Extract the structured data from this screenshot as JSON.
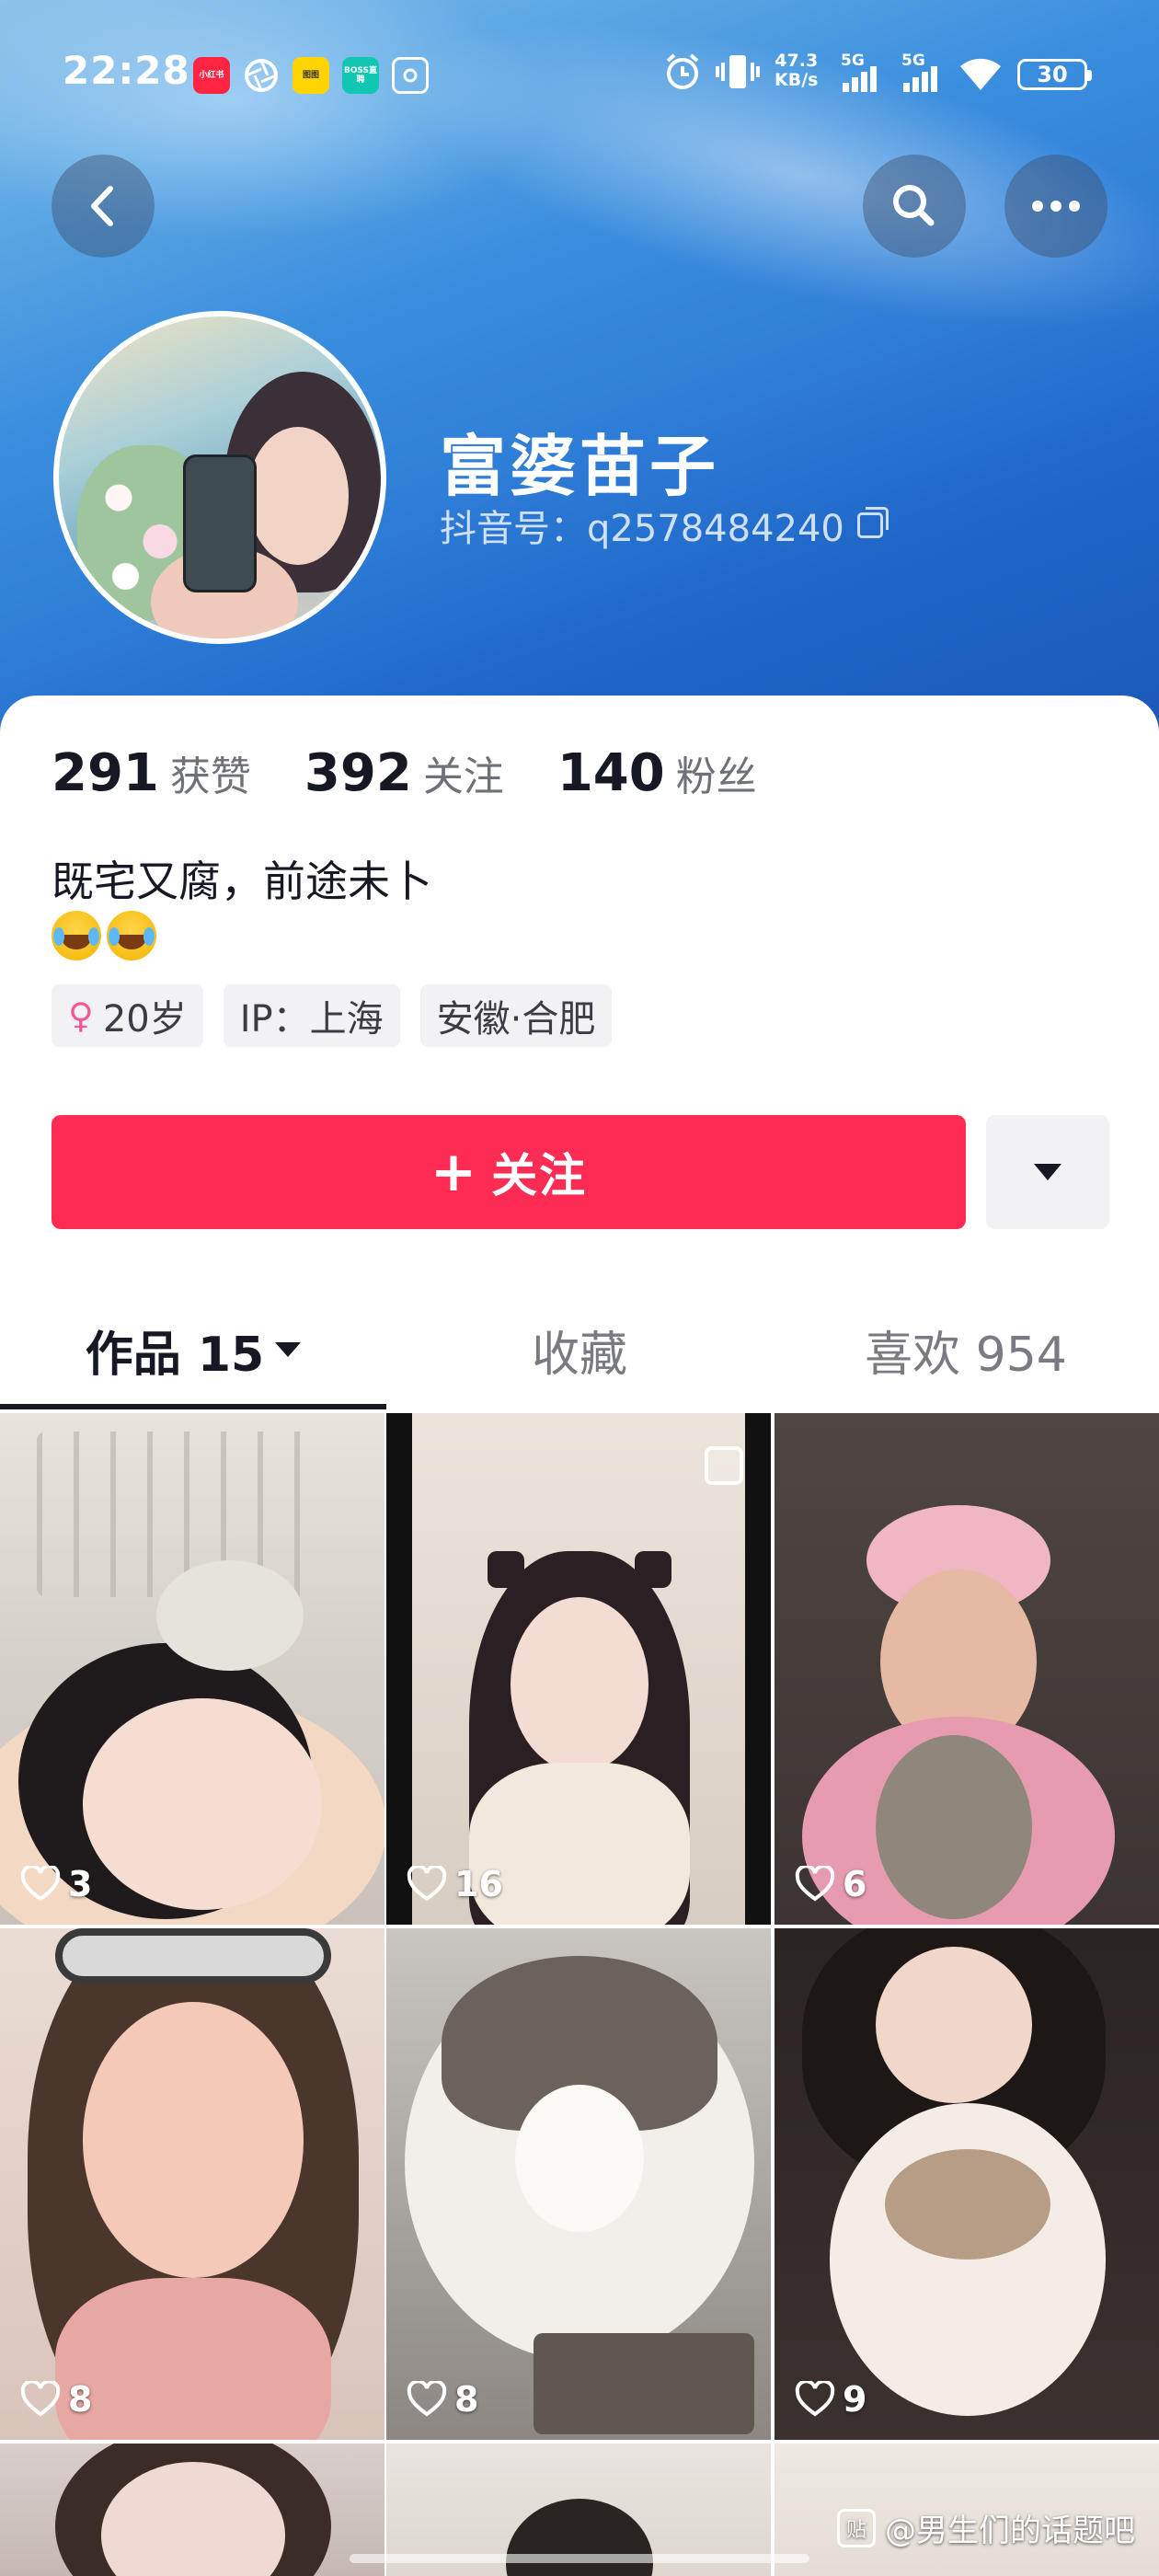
{
  "status": {
    "time": "22:28",
    "apps": [
      "小红书",
      "",
      "图图",
      "BOSS直聘",
      ""
    ],
    "net_speed": "47.3",
    "net_unit": "KB/s",
    "sig1": "5G",
    "sig2": "5G",
    "battery": "30"
  },
  "profile": {
    "name": "富婆苗子",
    "douyin_id": "抖音号：q2578484240"
  },
  "stats": [
    {
      "num": "291",
      "label": "获赞"
    },
    {
      "num": "392",
      "label": "关注"
    },
    {
      "num": "140",
      "label": "粉丝"
    }
  ],
  "bio": "既宅又腐，前途未卜",
  "tags": {
    "gender_symbol": "♀",
    "age": "20岁",
    "ip": "IP：上海",
    "location": "安徽·合肥"
  },
  "follow_label": "关注",
  "tabs": [
    "作品 15",
    "收藏",
    "喜欢 954"
  ],
  "videos": [
    {
      "likes": "3"
    },
    {
      "likes": "16"
    },
    {
      "likes": "6"
    },
    {
      "likes": "8"
    },
    {
      "likes": "8"
    },
    {
      "likes": "9"
    }
  ],
  "watermark": "@男生们的话题吧",
  "colors": {
    "accent": "#fe2c55",
    "text": "#161823",
    "header_blue": "#2f7fd8"
  }
}
